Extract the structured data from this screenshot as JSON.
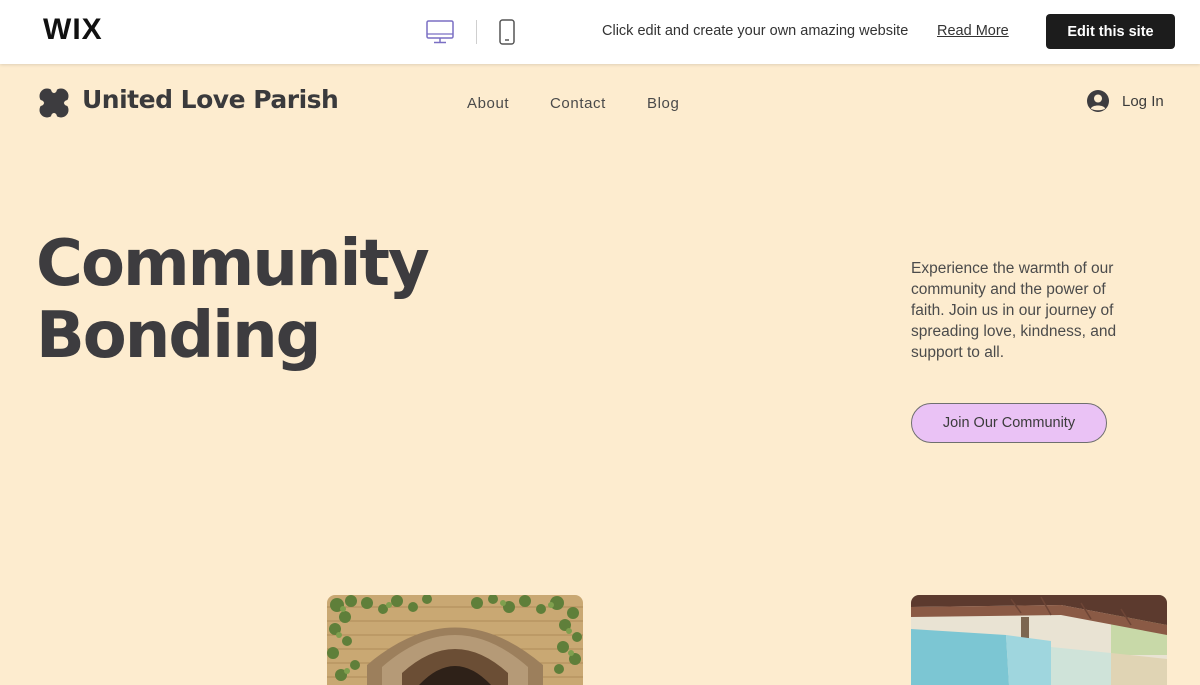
{
  "wix_bar": {
    "logo": "WIX",
    "promo_text": "Click edit and create your own amazing website",
    "read_more": "Read More",
    "edit_button": "Edit this site"
  },
  "site": {
    "name": "United Love Parish",
    "nav": [
      {
        "label": "About"
      },
      {
        "label": "Contact"
      },
      {
        "label": "Blog"
      }
    ],
    "login_label": "Log In"
  },
  "hero": {
    "title_line1": "Community",
    "title_line2": "Bonding",
    "description": "Experience the warmth of our community and the power of faith. Join us in our journey of spreading love, kindness, and support to all.",
    "cta": "Join Our Community"
  },
  "colors": {
    "page_background": "#fdeccf",
    "cta_background": "#eac2f5",
    "edit_button_background": "#1c1c1c",
    "desktop_icon_active": "#7a6fc4"
  },
  "icons": {
    "desktop": "desktop-monitor-icon",
    "mobile": "mobile-phone-icon",
    "logo": "four-petal-clover-icon",
    "login": "user-avatar-icon"
  }
}
